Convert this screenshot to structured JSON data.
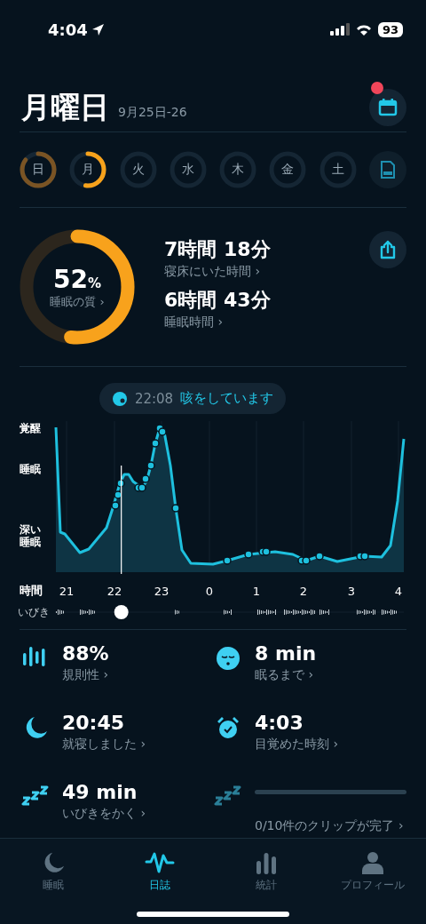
{
  "status_bar": {
    "time": "4:04",
    "battery": "93"
  },
  "header": {
    "title": "月曜日",
    "date": "9月25日-26",
    "notification": true
  },
  "days": [
    {
      "label": "日",
      "scored": true,
      "selected": false
    },
    {
      "label": "月",
      "scored": true,
      "selected": true
    },
    {
      "label": "火",
      "scored": false,
      "selected": false
    },
    {
      "label": "水",
      "scored": false,
      "selected": false
    },
    {
      "label": "木",
      "scored": false,
      "selected": false
    },
    {
      "label": "金",
      "scored": false,
      "selected": false
    },
    {
      "label": "土",
      "scored": false,
      "selected": false
    }
  ],
  "score": {
    "value": "52",
    "unit": "%",
    "label": "睡眠の質 ›",
    "level": 0.52
  },
  "durations": [
    {
      "value": "7時間 18分",
      "label": "寝床にいた時間 ›"
    },
    {
      "value": "6時間 43分",
      "label": "睡眠時間 ›"
    }
  ],
  "event": {
    "time": "22:08",
    "text": "咳をしています"
  },
  "chart": {
    "stage_labels": [
      "覚醒",
      "睡眠",
      "深い睡眠"
    ],
    "axis_label": "時間",
    "hours": [
      "21",
      "22",
      "23",
      "0",
      "1",
      "2",
      "3",
      "4"
    ],
    "snore": {
      "label": "いびき",
      "level": 0.19
    }
  },
  "stats": [
    {
      "kind": "stat",
      "value": "88%",
      "label": "規則性 ›"
    },
    {
      "kind": "stat",
      "value": "8 min",
      "label": "眠るまで ›"
    },
    {
      "kind": "stat",
      "value": "20:45",
      "label": "就寝しました ›"
    },
    {
      "kind": "stat",
      "value": "4:03",
      "label": "目覚めた時刻 ›"
    },
    {
      "kind": "stat",
      "value": "49 min",
      "label": "いびきをかく ›"
    },
    {
      "kind": "progress",
      "label": "0/10件のクリップが完了 ›"
    }
  ],
  "tabs": [
    {
      "label": "睡眠",
      "selected": false
    },
    {
      "label": "日誌",
      "selected": true
    },
    {
      "label": "統計",
      "selected": false
    },
    {
      "label": "プロフィール",
      "selected": false
    }
  ]
}
